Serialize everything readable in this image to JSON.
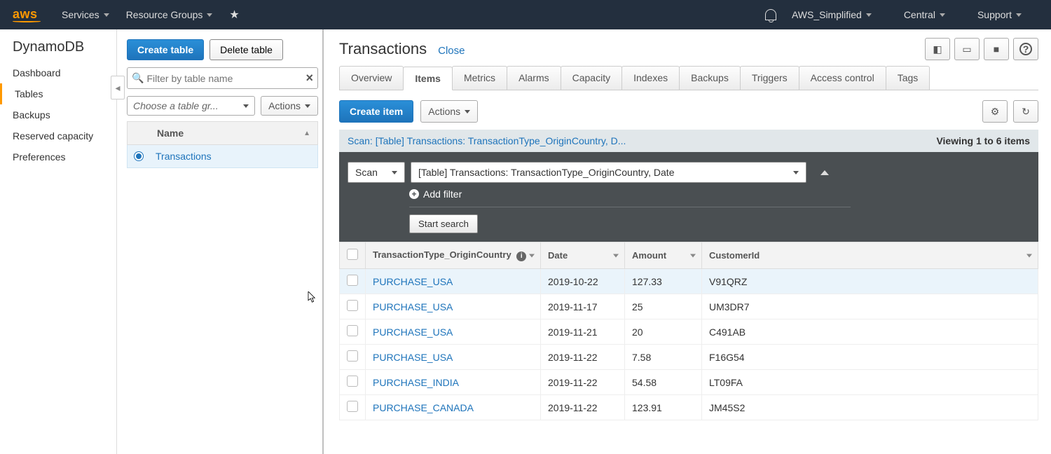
{
  "topnav": {
    "logo": "aws",
    "services": "Services",
    "resource_groups": "Resource Groups",
    "account": "AWS_Simplified",
    "region": "Central",
    "support": "Support"
  },
  "sidebar": {
    "title": "DynamoDB",
    "items": [
      "Dashboard",
      "Tables",
      "Backups",
      "Reserved capacity",
      "Preferences"
    ],
    "active_index": 1
  },
  "tables_panel": {
    "create": "Create table",
    "delete": "Delete table",
    "filter_placeholder": "Filter by table name",
    "group_placeholder": "Choose a table gr...",
    "actions": "Actions",
    "header": "Name",
    "rows": [
      "Transactions"
    ]
  },
  "main": {
    "title": "Transactions",
    "close": "Close",
    "tabs": [
      "Overview",
      "Items",
      "Metrics",
      "Alarms",
      "Capacity",
      "Indexes",
      "Backups",
      "Triggers",
      "Access control",
      "Tags"
    ],
    "active_tab_index": 1,
    "create_item": "Create item",
    "actions": "Actions",
    "scan_label": "Scan: [Table] Transactions: TransactionType_OriginCountry, D...",
    "viewing": "Viewing 1 to 6 items",
    "scan_select": "Scan",
    "index_select": "[Table] Transactions: TransactionType_OriginCountry, Date",
    "add_filter": "Add filter",
    "start_search": "Start search",
    "columns": [
      "TransactionType_OriginCountry",
      "Date",
      "Amount",
      "CustomerId"
    ],
    "rows": [
      {
        "pk": "PURCHASE_USA",
        "date": "2019-10-22",
        "amount": "127.33",
        "cust": "V91QRZ"
      },
      {
        "pk": "PURCHASE_USA",
        "date": "2019-11-17",
        "amount": "25",
        "cust": "UM3DR7"
      },
      {
        "pk": "PURCHASE_USA",
        "date": "2019-11-21",
        "amount": "20",
        "cust": "C491AB"
      },
      {
        "pk": "PURCHASE_USA",
        "date": "2019-11-22",
        "amount": "7.58",
        "cust": "F16G54"
      },
      {
        "pk": "PURCHASE_INDIA",
        "date": "2019-11-22",
        "amount": "54.58",
        "cust": "LT09FA"
      },
      {
        "pk": "PURCHASE_CANADA",
        "date": "2019-11-22",
        "amount": "123.91",
        "cust": "JM45S2"
      }
    ]
  }
}
